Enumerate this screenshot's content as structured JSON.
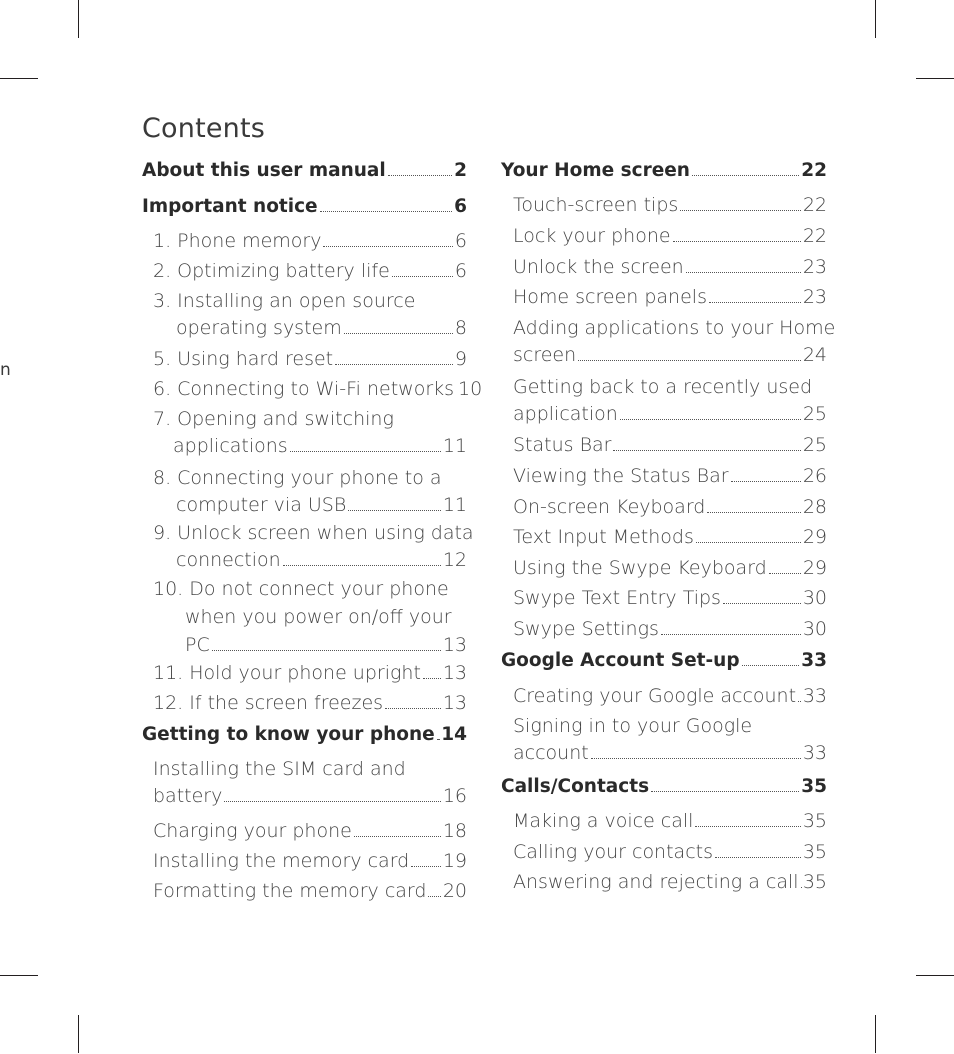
{
  "page": {
    "title": "Contents",
    "edge_letter": "n"
  },
  "left_column": [
    {
      "level": 1,
      "label": "About this user manual",
      "page": "2"
    },
    {
      "level": 1,
      "label": "Important notice",
      "page": "6"
    },
    {
      "level": 2,
      "label": "1. Phone memory",
      "page": "6"
    },
    {
      "level": 2,
      "label": "2. Optimizing battery life",
      "page": "6"
    },
    {
      "level": 2,
      "label_line1": "3. Installing an open source",
      "label": "operating system",
      "page": "8"
    },
    {
      "level": 2,
      "label": "5. Using hard reset",
      "page": "9"
    },
    {
      "level": 2,
      "label": "6. Connecting to Wi-Fi networks",
      "page": "10"
    },
    {
      "level": 2,
      "label_line1": "7. Opening and switching",
      "label": "applications",
      "page": "11"
    },
    {
      "level": 2,
      "label_line1": "8. Connecting your phone to a",
      "label": "computer via USB",
      "page": "11"
    },
    {
      "level": 2,
      "label_line1": "9. Unlock screen when using data",
      "label": "connection",
      "page": "12"
    },
    {
      "level": 2,
      "label_line1": "10. Do not connect your phone",
      "label_line2": "when you power on/off your",
      "label": "PC ",
      "page": "13"
    },
    {
      "level": 2,
      "label": "11. Hold your phone upright",
      "page": "13"
    },
    {
      "level": 2,
      "label": "12. If the screen freezes",
      "page": "13"
    },
    {
      "level": 1,
      "label": "Getting to know your phone",
      "page": "14"
    },
    {
      "level": 2,
      "label_line1": "Installing the SIM card and",
      "label": "battery",
      "page": "16"
    },
    {
      "level": 2,
      "label": "Charging your phone",
      "page": "18"
    },
    {
      "level": 2,
      "label": "Installing the memory card",
      "page": "19"
    },
    {
      "level": 2,
      "label": "Formatting the memory card",
      "page": "20"
    }
  ],
  "right_column": [
    {
      "level": 1,
      "label": "Your Home screen",
      "page": "22"
    },
    {
      "level": 2,
      "label": "Touch-screen tips",
      "page": "22"
    },
    {
      "level": 2,
      "label": "Lock your phone",
      "page": "22"
    },
    {
      "level": 2,
      "label": "Unlock the screen",
      "page": "23"
    },
    {
      "level": 2,
      "label": "Home screen panels",
      "page": "23"
    },
    {
      "level": 2,
      "label_line1": "Adding applications to your Home",
      "label": "screen",
      "page": "24"
    },
    {
      "level": 2,
      "label_line1": "Getting back to a recently used",
      "label": "application",
      "page": "25"
    },
    {
      "level": 2,
      "label": "Status Bar",
      "page": "25"
    },
    {
      "level": 2,
      "label": "Viewing the Status Bar",
      "page": "26"
    },
    {
      "level": 2,
      "label": "On-screen Keyboard",
      "page": "28"
    },
    {
      "level": 2,
      "label": "Text Input Methods",
      "page": "29"
    },
    {
      "level": 2,
      "label": "Using the Swype Keyboard",
      "page": "29"
    },
    {
      "level": 2,
      "label": "Swype Text Entry Tips",
      "page": "30"
    },
    {
      "level": 2,
      "label": "Swype Settings",
      "page": "30"
    },
    {
      "level": 1,
      "label": "Google Account Set-up",
      "page": "33"
    },
    {
      "level": 2,
      "label": "Creating your Google account",
      "page": "33"
    },
    {
      "level": 2,
      "label_line1": "Signing in to your Google",
      "label": "account",
      "page": "33"
    },
    {
      "level": 1,
      "label": "Calls/Contacts",
      "page": "35"
    },
    {
      "level": 2,
      "label": "Making a voice call",
      "page": "35"
    },
    {
      "level": 2,
      "label": "Calling your contacts",
      "page": "35"
    },
    {
      "level": 2,
      "label": "Answering and rejecting a call",
      "page": "35"
    }
  ]
}
